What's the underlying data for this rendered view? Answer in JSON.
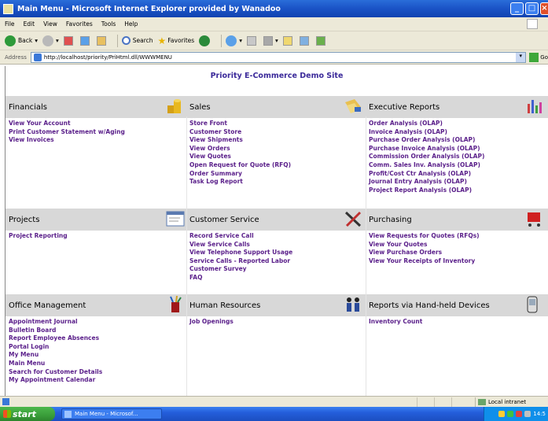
{
  "window": {
    "title": "Main Menu - Microsoft Internet Explorer provided by Wanadoo",
    "minimize": "_",
    "maximize": "□",
    "close": "×"
  },
  "menubar": [
    "File",
    "Edit",
    "View",
    "Favorites",
    "Tools",
    "Help"
  ],
  "toolbar": {
    "back": "Back",
    "search": "Search",
    "favorites": "Favorites"
  },
  "address": {
    "label": "Address",
    "url": "http://localhost/priority/PriHtml.dll/WWWMENU",
    "go": "Go"
  },
  "site_title": "Priority E-Commerce Demo Site",
  "sections": {
    "financials": {
      "title": "Financials",
      "icon": "coins-icon",
      "links": [
        "View Your Account",
        "Print Customer Statement w/Aging",
        "View Invoices"
      ]
    },
    "sales": {
      "title": "Sales",
      "icon": "papers-icon",
      "links": [
        "Store Front",
        "Customer Store",
        "View Shipments",
        "View Orders",
        "View Quotes",
        "Open Request for Quote (RFQ)",
        "Order Summary",
        "Task Log Report"
      ]
    },
    "executive_reports": {
      "title": "Executive Reports",
      "icon": "bar-chart-icon",
      "links": [
        "Order Analysis (OLAP)",
        "Invoice Analysis (OLAP)",
        "Purchase Order Analysis (OLAP)",
        "Purchase Invoice Analysis (OLAP)",
        "Commission Order Analysis (OLAP)",
        "Comm. Sales Inv. Analysis (OLAP)",
        "Profit/Cost Ctr Analysis (OLAP)",
        "Journal Entry Analysis (OLAP)",
        "Project Report Analysis (OLAP)"
      ]
    },
    "projects": {
      "title": "Projects",
      "icon": "window-icon",
      "links": [
        "Project Reporting"
      ]
    },
    "customer_service": {
      "title": "Customer Service",
      "icon": "tools-icon",
      "links": [
        "Record Service Call",
        "View Service Calls",
        "View Telephone Support Usage",
        "Service Calls - Reported Labor",
        "Customer Survey",
        "FAQ"
      ]
    },
    "purchasing": {
      "title": "Purchasing",
      "icon": "cart-icon",
      "links": [
        "View Requests for Quotes (RFQs)",
        "View Your Quotes",
        "View Purchase Orders",
        "View Your Receipts of Inventory"
      ]
    },
    "office_management": {
      "title": "Office Management",
      "icon": "pencil-cup-icon",
      "links": [
        "Appointment Journal",
        "Bulletin Board",
        "Report Employee Absences",
        "Portal Login",
        "My Menu",
        "Main Menu",
        "Search for Customer Details",
        "My Appointment Calendar"
      ]
    },
    "human_resources": {
      "title": "Human Resources",
      "icon": "people-icon",
      "links": [
        "Job Openings"
      ]
    },
    "handheld": {
      "title": "Reports via Hand-held Devices",
      "icon": "handheld-icon",
      "links": [
        "Inventory Count"
      ]
    }
  },
  "statusbar": {
    "zone": "Local intranet"
  },
  "taskbar": {
    "start": "start",
    "task": "Main Menu - Microsof...",
    "clock": "14:5"
  },
  "colors": {
    "link": "#5a1f8a",
    "site_title": "#3b2a9a",
    "section_band": "#d8d8d8"
  }
}
